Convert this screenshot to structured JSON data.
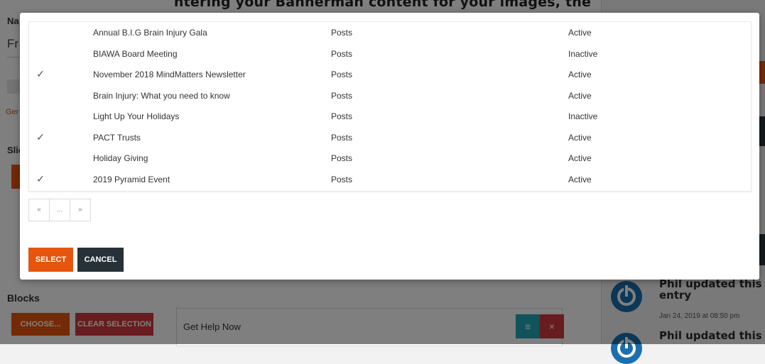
{
  "background": {
    "heading_fragment": "ntering your Bannerman content for your images, the",
    "left_label": "Na",
    "left_field": "Fr",
    "left_link": "Ger",
    "left_section": "Slic",
    "blocks_title": "Blocks",
    "choose_label": "CHOOSE...",
    "clear_selection_label": "CLEAR SELECTION",
    "help_card_title": "Get Help Now",
    "help_menu_icon": "≡",
    "help_close_icon": "×",
    "activity": [
      {
        "title": "Phil updated this entry",
        "time": "Jan 24, 2019 at 08:50 pm"
      },
      {
        "title": "Phil updated this",
        "time": ""
      }
    ]
  },
  "modal": {
    "rows": [
      {
        "checked": false,
        "title": "Annual B.I.G Brain Injury Gala",
        "type": "Posts",
        "status": "Active"
      },
      {
        "checked": false,
        "title": "BIAWA Board Meeting",
        "type": "Posts",
        "status": "Inactive"
      },
      {
        "checked": true,
        "title": "November 2018 MindMatters Newsletter",
        "type": "Posts",
        "status": "Active"
      },
      {
        "checked": false,
        "title": "Brain Injury: What you need to know",
        "type": "Posts",
        "status": "Active"
      },
      {
        "checked": false,
        "title": "Light Up Your Holidays",
        "type": "Posts",
        "status": "Inactive"
      },
      {
        "checked": true,
        "title": "PACT Trusts",
        "type": "Posts",
        "status": "Active"
      },
      {
        "checked": false,
        "title": "Holiday Giving",
        "type": "Posts",
        "status": "Active"
      },
      {
        "checked": true,
        "title": "2019 Pyramid Event",
        "type": "Posts",
        "status": "Active"
      }
    ],
    "check_glyph": "✓",
    "pagination": {
      "prev": "«",
      "ellipsis": "...",
      "next": "»"
    },
    "select_label": "SELECT",
    "cancel_label": "CANCEL"
  }
}
